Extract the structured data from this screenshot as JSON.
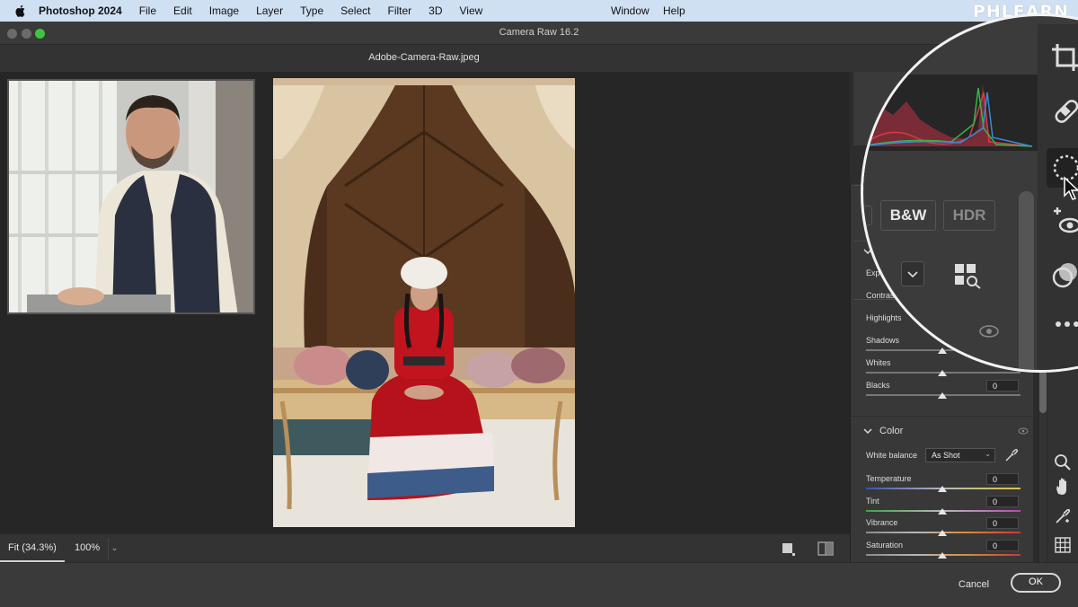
{
  "menubar": {
    "app": "Photoshop 2024",
    "items": [
      "File",
      "Edit",
      "Image",
      "Layer",
      "Type",
      "Select",
      "Filter",
      "3D",
      "View"
    ],
    "right_items": [
      "Window",
      "Help"
    ],
    "brand": "PHLEARN"
  },
  "window": {
    "title": "Camera Raw 16.2",
    "filename": "Adobe-Camera-Raw.jpeg",
    "traffic_colors": [
      "#6b6b6b",
      "#6b6b6b",
      "#3ec43e"
    ]
  },
  "zoom": {
    "fit": "Fit (34.3%)",
    "percent": "100%"
  },
  "profile": {
    "bw": "B&W",
    "hdr": "HDR"
  },
  "light": {
    "exposure_label": "Expo",
    "rows": [
      {
        "label": "Contrast"
      },
      {
        "label": "Highlights"
      },
      {
        "label": "Shadows"
      },
      {
        "label": "Whites"
      },
      {
        "label": "Blacks",
        "value": "0"
      }
    ]
  },
  "color": {
    "title": "Color",
    "white_balance_label": "White balance",
    "white_balance_value": "As Shot",
    "rows": [
      {
        "label": "Temperature",
        "value": "0"
      },
      {
        "label": "Tint",
        "value": "0"
      },
      {
        "label": "Vibrance",
        "value": "0"
      },
      {
        "label": "Saturation",
        "value": "0"
      }
    ]
  },
  "footer": {
    "cancel": "Cancel",
    "ok": "OK"
  },
  "icons": [
    "apple-icon",
    "crop-icon",
    "healing-icon",
    "masking-icon",
    "red-eye-icon",
    "presets-icon",
    "more-icon",
    "zoom-icon",
    "hand-icon",
    "sampler-icon",
    "grid-icon",
    "eye-icon",
    "cursor-icon"
  ]
}
